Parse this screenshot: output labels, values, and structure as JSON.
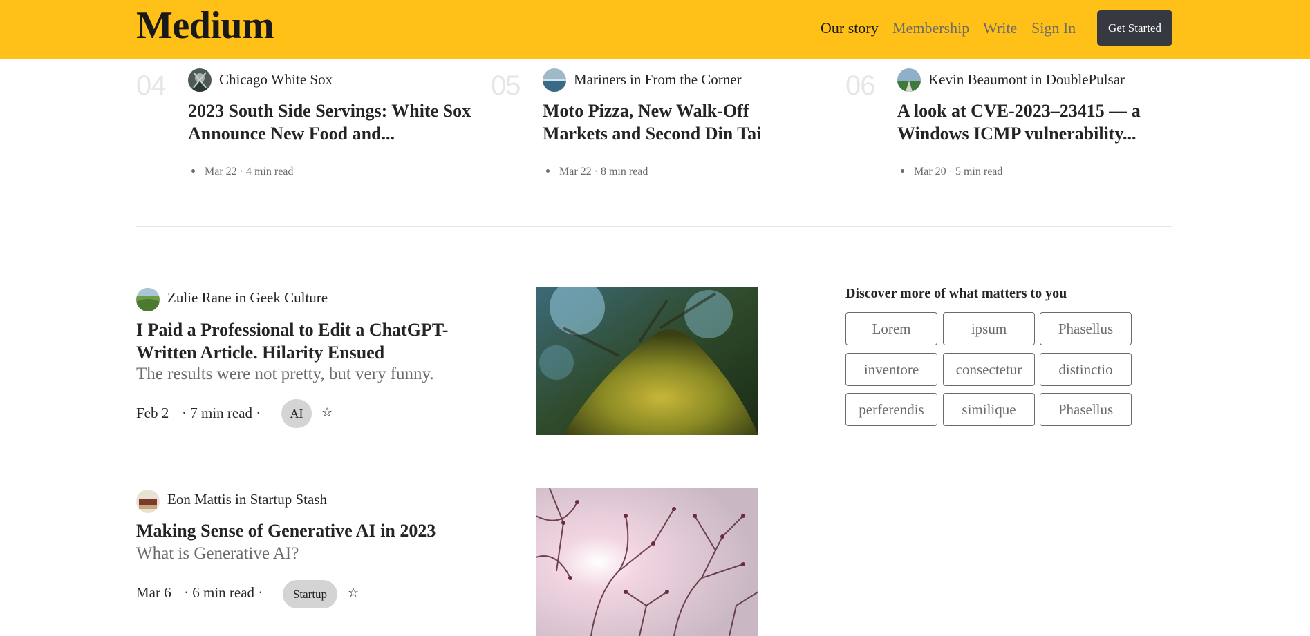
{
  "header": {
    "logo": "Medium",
    "nav": {
      "our_story": "Our story",
      "membership": "Membership",
      "write": "Write",
      "sign_in": "Sign In"
    },
    "get_started": "Get Started",
    "background_color": "#ffc017"
  },
  "trending": [
    {
      "number": "04",
      "author": "Chicago White Sox",
      "title": "2023 South Side Servings: White Sox Announce New Food and...",
      "date": "Mar 22",
      "read_time": "4 min read"
    },
    {
      "number": "05",
      "author": "Mariners in From the Corner",
      "title": "Moto Pizza, New Walk-Off Markets and Second Din Tai",
      "date": "Mar 22",
      "read_time": "8 min read"
    },
    {
      "number": "06",
      "author": "Kevin Beaumont in DoublePulsar",
      "title": "A look at CVE-2023–23415 — a Windows ICMP vulnerability...",
      "date": "Mar 20",
      "read_time": "5 min read"
    }
  ],
  "articles": [
    {
      "author": "Zulie Rane in Geek Culture",
      "title_line1": "I Paid a Professional to Edit a ChatGPT-",
      "title_line2": "Written Article. Hilarity Ensued",
      "subtitle": "The results were not pretty, but very funny.",
      "date": "Feb 2",
      "read_time": "· 7 min read ·",
      "tag": "AI",
      "bookmark_icon": "star-icon"
    },
    {
      "author": "Eon Mattis in Startup Stash",
      "title": "Making Sense of Generative AI in 2023",
      "subtitle": "What is Generative AI?",
      "date": "Mar 6",
      "read_time": "· 6 min read ·",
      "tag": "Startup",
      "bookmark_icon": "star-icon"
    }
  ],
  "discover": {
    "title": "Discover more of what matters to you",
    "topics": [
      "Lorem",
      "ipsum",
      "Phasellus",
      "inventore",
      "consectetur",
      "distinctio",
      "perferendis",
      "similique",
      "Phasellus"
    ]
  }
}
